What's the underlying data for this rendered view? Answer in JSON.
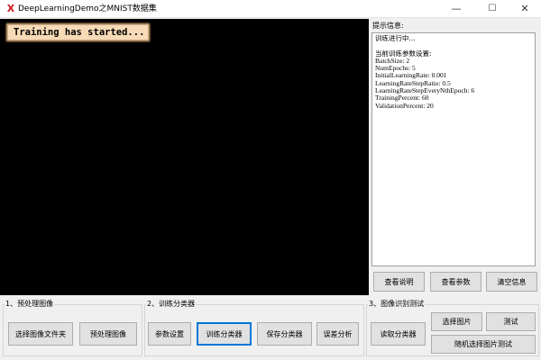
{
  "window": {
    "title": "DeepLearningDemo之MNIST数据集",
    "app_icon": "X",
    "minimize_glyph": "—",
    "maximize_glyph": "☐",
    "close_glyph": "✕"
  },
  "canvas": {
    "banner": "Training has started..."
  },
  "info_panel": {
    "label": "提示信息:",
    "lines": [
      "训练进行中...",
      "",
      "当前训练参数设置:",
      "BatchSize: 2",
      "NumEpochs: 5",
      "InitialLearningRate: 0.001",
      "LearningRateStepRatio: 0.5",
      "LearningRateStepEveryNthEpoch: 6",
      "TrainingPercent: 60",
      "ValidationPercent: 20"
    ],
    "buttons": {
      "view_help": "查看说明",
      "view_params": "查看参数",
      "clear_info": "清空信息"
    }
  },
  "group1": {
    "label": "1、预处理图像",
    "select_folder": "选择图像文件夹",
    "preprocess": "预处理图像"
  },
  "group2": {
    "label": "2、训练分类器",
    "param_settings": "参数设置",
    "train": "训练分类器",
    "save": "保存分类器",
    "error_analysis": "误差分析"
  },
  "group3": {
    "label": "3、图像识别测试",
    "load": "读取分类器",
    "select_image": "选择图片",
    "test": "测试",
    "random_test": "随机选择图片测试"
  }
}
